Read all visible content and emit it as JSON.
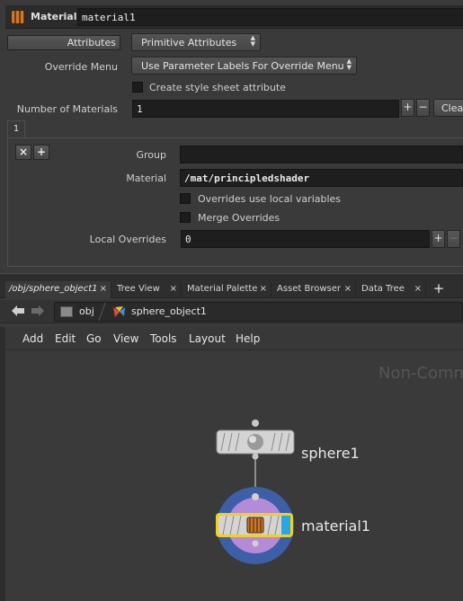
{
  "header": {
    "node_type": "Material",
    "node_name": "material1"
  },
  "params": {
    "attributes_tab": "Attributes",
    "attribute_class": "Primitive Attributes",
    "override_menu_label": "Override Menu",
    "override_menu_value": "Use Parameter Labels For Override Menu",
    "create_style_sheet_label": "Create style sheet attribute",
    "num_materials_label": "Number of Materials",
    "num_materials_value": "1",
    "plus": "+",
    "minus": "−",
    "clear_label": "Clear",
    "multiparm_tab": "1",
    "remove_icon": "×",
    "add_icon": "+",
    "group_label": "Group",
    "group_value": "",
    "material_label": "Material",
    "material_value": "/mat/principledshader",
    "overrides_local_label": "Overrides use local variables",
    "merge_overrides_label": "Merge Overrides",
    "local_overrides_label": "Local Overrides",
    "local_overrides_value": "0"
  },
  "network": {
    "tabs": [
      {
        "label": "/obj/sphere_object1",
        "close": "×"
      },
      {
        "label": "Tree View",
        "close": "×"
      },
      {
        "label": "Material Palette",
        "close": "×"
      },
      {
        "label": "Asset Browser",
        "close": "×"
      },
      {
        "label": "Data Tree",
        "close": "×"
      }
    ],
    "add_tab": "+",
    "back_icon": "arrow-left-icon",
    "forward_icon": "arrow-right-icon",
    "path": [
      {
        "label": "obj",
        "icon": "obj-context-icon"
      },
      {
        "label": "sphere_object1",
        "icon": "geometry-object-icon"
      }
    ],
    "menu": [
      "Add",
      "Edit",
      "Go",
      "View",
      "Tools",
      "Layout",
      "Help"
    ],
    "watermark": "Non-Comm",
    "nodes": [
      {
        "name": "sphere1",
        "icon": "sphere-icon"
      },
      {
        "name": "material1",
        "icon": "material-icon"
      }
    ],
    "colors": {
      "selected_outline": "#f0d020",
      "display_flag": "#2aa6e0",
      "ring_outer": "#3d5fa8",
      "ring_inner": "#b58ad8"
    }
  }
}
